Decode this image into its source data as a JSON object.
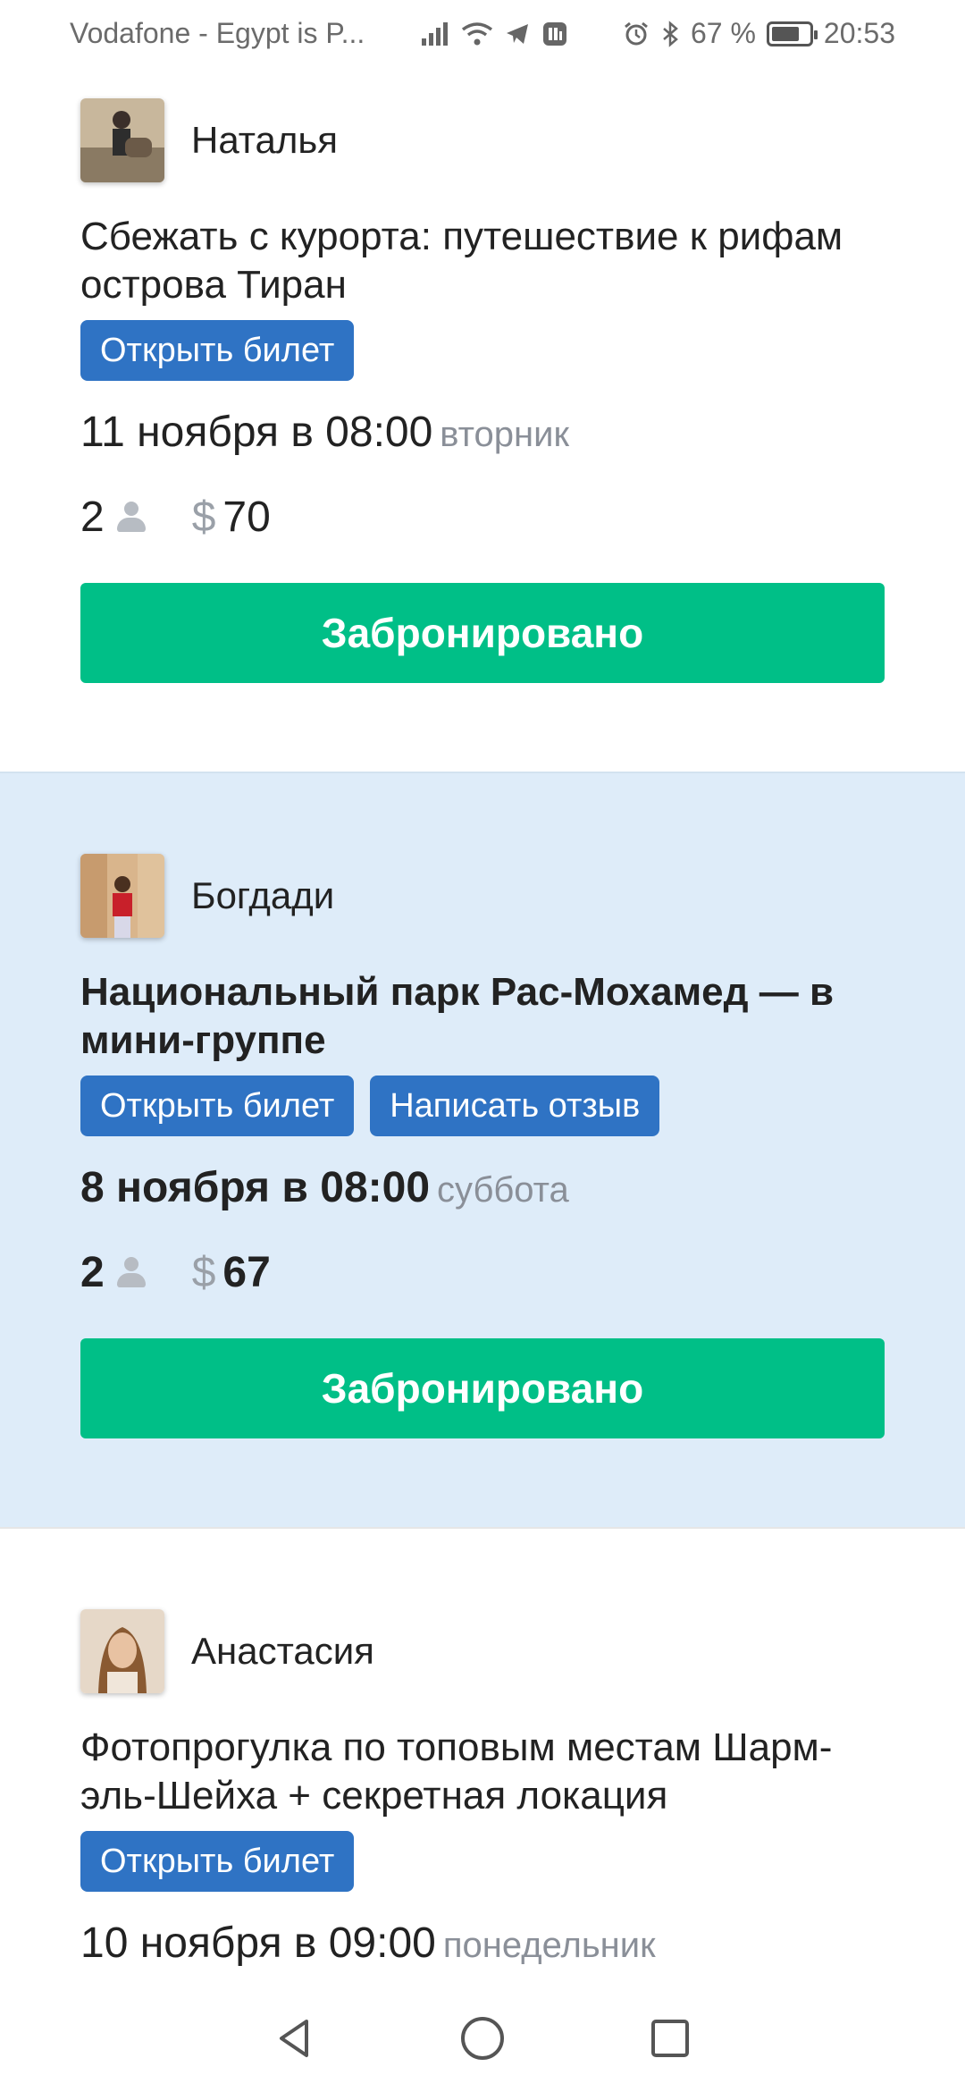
{
  "status_bar": {
    "carrier": "Vodafone - Egypt is P...",
    "battery": "67 %",
    "time": "20:53"
  },
  "bookings": [
    {
      "author": "Наталья",
      "title": "Сбежать с курорта: путешествие к рифам острова Тиран",
      "buttons": [
        "Открыть билет"
      ],
      "date": "11 ноября в 08:00",
      "weekday": "вторник",
      "persons": "2",
      "price": "70",
      "status_button": "Забронировано"
    },
    {
      "author": "Богдади",
      "title": "Национальный парк Рас-Мохамед — в мини-группе",
      "buttons": [
        "Открыть билет",
        "Написать отзыв"
      ],
      "date": "8 ноября в 08:00",
      "weekday": "суббота",
      "persons": "2",
      "price": "67",
      "status_button": "Забронировано"
    },
    {
      "author": "Анастасия",
      "title": "Фотопрогулка по топовым местам Шарм-эль-Шейха + секретная локация",
      "buttons": [
        "Открыть билет"
      ],
      "date": "10 ноября в 09:00",
      "weekday": "понедельник"
    }
  ],
  "currency_symbol": "$",
  "colors": {
    "highlight_bg": "#deecf9",
    "tag_button": "#2f73c4",
    "book_button": "#00bf87"
  }
}
